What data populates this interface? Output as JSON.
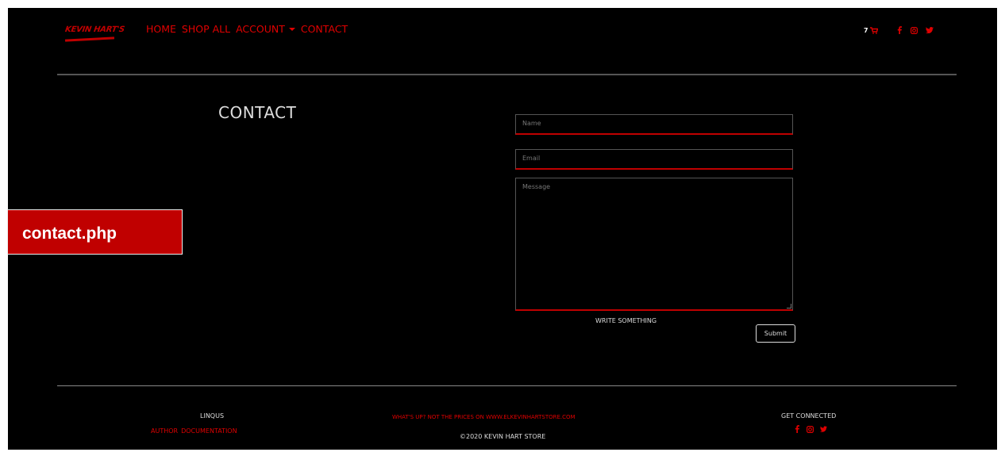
{
  "header": {
    "logo_text": "KEVIN HART'S",
    "nav": [
      "HOME",
      "SHOP ALL",
      "ACCOUNT",
      "CONTACT"
    ],
    "cart_count": "7",
    "icons": [
      "cart-icon",
      "facebook-icon",
      "instagram-icon",
      "twitter-icon"
    ]
  },
  "contact": {
    "title": "CONTACT",
    "name_placeholder": "Name",
    "email_placeholder": "Email",
    "message_placeholder": "Message",
    "write_label": "WRITE SOMETHING",
    "submit_label": "Submit"
  },
  "badge": {
    "label": "contact.php"
  },
  "footer": {
    "linqus": "LINQUS",
    "links": [
      "AUTHOR",
      "DOCUMENTATION"
    ],
    "tagline": "WHAT'S UP? NOT THE PRICES ON WWW.ELKEVINHARTSTORE.COM",
    "copyright": "©2020 KEVIN HART STORE",
    "connect": "GET CONNECTED"
  },
  "colors": {
    "accent": "#e00000",
    "background": "#000000",
    "badge": "#c00000"
  }
}
